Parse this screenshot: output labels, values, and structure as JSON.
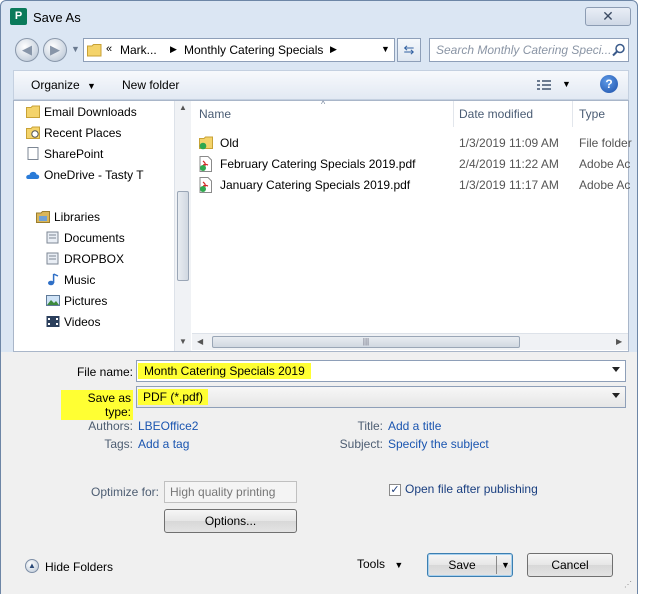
{
  "window": {
    "title": "Save As"
  },
  "nav": {
    "path": [
      "Mark...",
      "Monthly Catering Specials"
    ],
    "search_placeholder": "Search Monthly Catering Speci..."
  },
  "toolbar": {
    "organize": "Organize",
    "new_folder": "New folder"
  },
  "sidebar": {
    "items": [
      {
        "label": "Email Downloads",
        "icon": "folder-icon"
      },
      {
        "label": "Recent Places",
        "icon": "recent-places-icon"
      },
      {
        "label": "SharePoint",
        "icon": "page-icon"
      },
      {
        "label": "OneDrive - Tasty T",
        "icon": "cloud-icon"
      },
      {
        "label": "Libraries",
        "icon": "libraries-icon"
      },
      {
        "label": "Documents",
        "icon": "documents-icon"
      },
      {
        "label": "DROPBOX",
        "icon": "documents-icon"
      },
      {
        "label": "Music",
        "icon": "music-icon"
      },
      {
        "label": "Pictures",
        "icon": "pictures-icon"
      },
      {
        "label": "Videos",
        "icon": "videos-icon"
      }
    ]
  },
  "file_list": {
    "columns": [
      "Name",
      "Date modified",
      "Type"
    ],
    "rows": [
      {
        "name": "Old",
        "date": "1/3/2019 11:09 AM",
        "type": "File folder",
        "icon": "folder-icon"
      },
      {
        "name": "February Catering Specials 2019.pdf",
        "date": "2/4/2019 11:22 AM",
        "type": "Adobe Ac",
        "icon": "pdf-icon"
      },
      {
        "name": "January Catering Specials 2019.pdf",
        "date": "1/3/2019 11:17 AM",
        "type": "Adobe Ac",
        "icon": "pdf-icon"
      }
    ]
  },
  "form": {
    "file_name_label": "File name:",
    "file_name_value": "Month Catering Specials 2019",
    "save_type_label": "Save as type:",
    "save_type_value": "PDF (*.pdf)",
    "authors_label": "Authors:",
    "authors_value": "LBEOffice2",
    "tags_label": "Tags:",
    "tags_value": "Add a tag",
    "title_label": "Title:",
    "title_value": "Add a title",
    "subject_label": "Subject:",
    "subject_value": "Specify the subject",
    "optimize_label": "Optimize for:",
    "optimize_value": "High quality printing",
    "options_button": "Options...",
    "open_after_label": "Open file after publishing",
    "open_after_checked": true
  },
  "footer": {
    "hide_folders": "Hide Folders",
    "tools": "Tools",
    "save": "Save",
    "cancel": "Cancel"
  },
  "colors": {
    "highlight": "#ffff33",
    "link": "#1a55b0",
    "frame": "#dbe6f3"
  }
}
